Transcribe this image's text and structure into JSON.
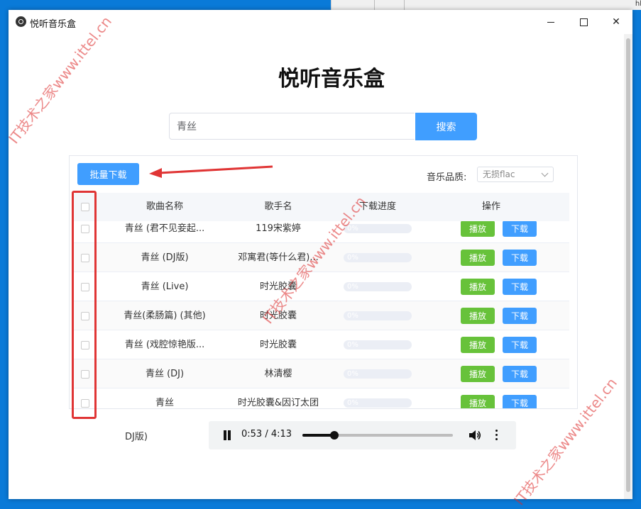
{
  "window": {
    "title": "悦听音乐盒",
    "controls": {
      "minimize": "minimize",
      "maximize": "maximize",
      "close": "✕"
    }
  },
  "desktop": {
    "corner_text": "hl"
  },
  "app": {
    "title": "悦听音乐盒"
  },
  "search": {
    "value": "青丝",
    "button_label": "搜索"
  },
  "toolbar": {
    "batch_download_label": "批量下载",
    "quality_label": "音乐品质:",
    "quality_value": "无损flac"
  },
  "table": {
    "headers": {
      "title": "歌曲名称",
      "artist": "歌手名",
      "progress": "下载进度",
      "actions": "操作"
    },
    "rows": [
      {
        "title": "青丝 (君不见妾起...",
        "artist": "119宋紫婷",
        "progress": "0%",
        "play": "播放",
        "download": "下载"
      },
      {
        "title": "青丝 (DJ版)",
        "artist": "邓寓君(等什么君)...",
        "progress": "0%",
        "play": "播放",
        "download": "下载"
      },
      {
        "title": "青丝 (Live)",
        "artist": "时光胶囊",
        "progress": "0%",
        "play": "播放",
        "download": "下载"
      },
      {
        "title": "青丝(柔肠篇) (其他)",
        "artist": "时光胶囊",
        "progress": "0%",
        "play": "播放",
        "download": "下载"
      },
      {
        "title": "青丝 (戏腔惊艳版...",
        "artist": "时光胶囊",
        "progress": "0%",
        "play": "播放",
        "download": "下载"
      },
      {
        "title": "青丝 (DJ)",
        "artist": "林清樱",
        "progress": "0%",
        "play": "播放",
        "download": "下载"
      },
      {
        "title": "青丝",
        "artist": "时光胶囊&因订太团",
        "progress": "0%",
        "play": "播放",
        "download": "下载"
      }
    ]
  },
  "player": {
    "now_playing": "DJ版)",
    "time": "0:53 / 4:13",
    "progress_fraction": 0.21
  },
  "watermarks": [
    "IT技术之家www.ittel.cn",
    "IT技术之家www.ittel.cn",
    "IT技术之家www.ittel.cn"
  ],
  "colors": {
    "primary": "#409eff",
    "success": "#67c23a",
    "annotation": "#e03535",
    "desktop": "#0a7ad8"
  },
  "icons": [
    "app-icon",
    "chevron-down-icon",
    "pause-icon",
    "volume-icon",
    "more-vertical-icon",
    "arrow-annotation"
  ]
}
